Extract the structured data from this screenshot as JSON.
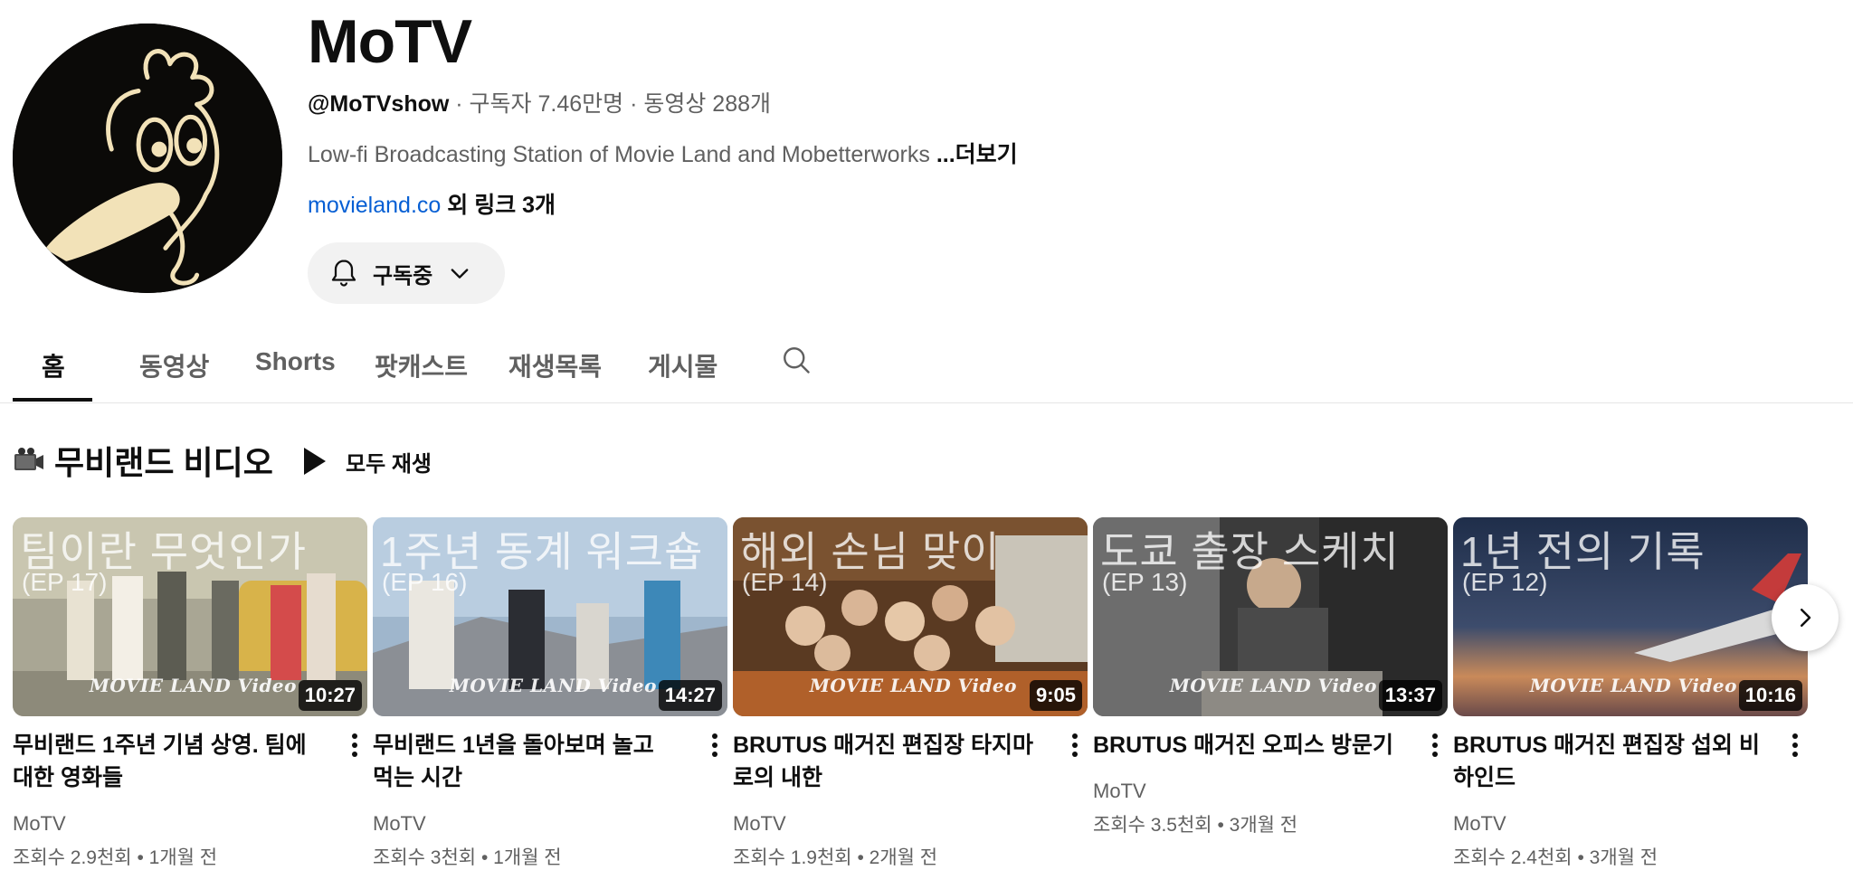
{
  "channel": {
    "title": "MoTV",
    "handle": "@MoTVshow",
    "subscribers": " · 구독자 7.46만명 · 동영상 288개",
    "description": "Low-fi Broadcasting Station of Movie Land and Mobetterworks ",
    "more_label": "...더보기",
    "link_url": "movieland.co",
    "link_extra": " 외 링크 3개",
    "subscribe_label": "구독중",
    "avatar_icon": "bird-cartoon-logo"
  },
  "tabs": [
    {
      "label": "홈",
      "active": true
    },
    {
      "label": "동영상"
    },
    {
      "label": "Shorts"
    },
    {
      "label": "팟캐스트"
    },
    {
      "label": "재생목록"
    },
    {
      "label": "게시물"
    }
  ],
  "section": {
    "icon": "video-camera-icon",
    "title": "무비랜드 비디오",
    "play_all_label": "모두 재생"
  },
  "videos": [
    {
      "thumb_title": "팀이란 무엇인가",
      "thumb_ep": "(EP 17)",
      "logo": "MOVIE LAND Video",
      "duration": "10:27",
      "title": "무비랜드 1주년 기념 상영. 팀에 대한 영화들",
      "channel": "MoTV",
      "stats": "조회수 2.9천회 • 1개월 전"
    },
    {
      "thumb_title": "1주년 동계 워크숍",
      "thumb_ep": "(EP 16)",
      "logo": "MOVIE LAND Video",
      "duration": "14:27",
      "title": "무비랜드 1년을 돌아보며 놀고 먹는 시간",
      "channel": "MoTV",
      "stats": "조회수 3천회 • 1개월 전"
    },
    {
      "thumb_title": "해외 손님 맞이",
      "thumb_ep": "(EP 14)",
      "logo": "MOVIE LAND Video",
      "duration": "9:05",
      "title": "BRUTUS 매거진 편집장 타지마로의 내한",
      "channel": "MoTV",
      "stats": "조회수 1.9천회 • 2개월 전"
    },
    {
      "thumb_title": "도쿄 출장 스케치",
      "thumb_ep": "(EP 13)",
      "logo": "MOVIE LAND Video",
      "duration": "13:37",
      "title": "BRUTUS 매거진 오피스 방문기",
      "channel": "MoTV",
      "stats": "조회수 3.5천회 • 3개월 전"
    },
    {
      "thumb_title": "1년 전의 기록",
      "thumb_ep": "(EP 12)",
      "logo": "MOVIE LAND Video",
      "duration": "10:16",
      "title": "BRUTUS 매거진 편집장 섭외 비하인드",
      "channel": "MoTV",
      "stats": "조회수 2.4천회 • 3개월 전"
    }
  ],
  "colors": {
    "link": "#065fd4",
    "text": "#0f0f0f",
    "secondary": "#606060"
  }
}
